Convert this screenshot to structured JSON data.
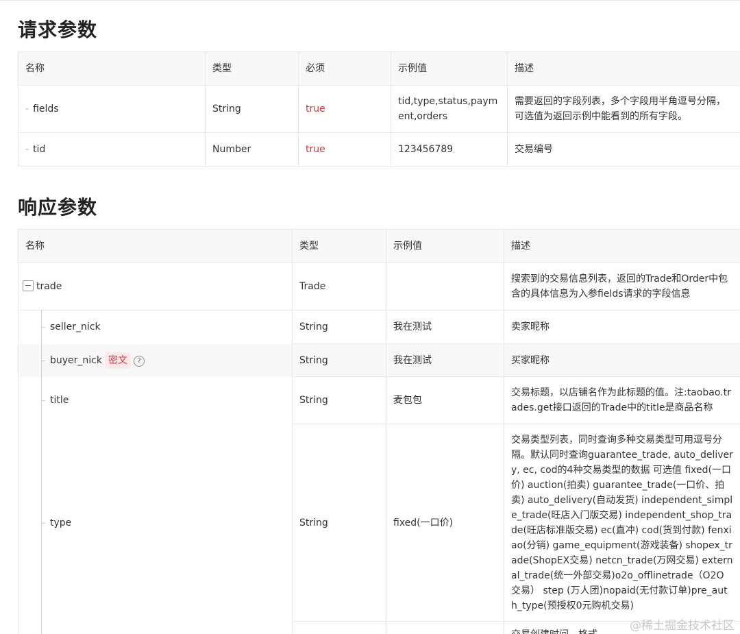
{
  "request": {
    "title": "请求参数",
    "headers": [
      "名称",
      "类型",
      "必须",
      "示例值",
      "描述"
    ],
    "rows": [
      {
        "name": "fields",
        "type": "String",
        "required": "true",
        "example": "tid,type,status,payment,orders",
        "desc": "需要返回的字段列表，多个字段用半角逗号分隔，可选值为返回示例中能看到的所有字段。"
      },
      {
        "name": "tid",
        "type": "Number",
        "required": "true",
        "example": "123456789",
        "desc": "交易编号"
      }
    ]
  },
  "response": {
    "title": "响应参数",
    "headers": [
      "名称",
      "类型",
      "示例值",
      "描述"
    ],
    "rows": [
      {
        "name": "trade",
        "type": "Trade",
        "example": "",
        "desc": "搜索到的交易信息列表，返回的Trade和Order中包含的具体信息为入参fields请求的字段信息"
      },
      {
        "name": "seller_nick",
        "type": "String",
        "example": "我在测试",
        "desc": "卖家昵称"
      },
      {
        "name": "buyer_nick",
        "badge": "密文",
        "type": "String",
        "example": "我在测试",
        "desc": "买家昵称"
      },
      {
        "name": "title",
        "type": "String",
        "example": "麦包包",
        "desc": "交易标题，以店铺名作为此标题的值。注:taobao.trades.get接口返回的Trade中的title是商品名称"
      },
      {
        "name": "type",
        "type": "String",
        "example": "fixed(一口价)",
        "desc": "交易类型列表，同时查询多种交易类型可用逗号分隔。默认同时查询guarantee_trade, auto_delivery, ec, cod的4种交易类型的数据 可选值 fixed(一口价) auction(拍卖) guarantee_trade(一口价、拍卖) auto_delivery(自动发货) independent_simple_trade(旺店入门版交易) independent_shop_trade(旺店标准版交易) ec(直冲) cod(货到付款) fenxiao(分销) game_equipment(游戏装备) shopex_trade(ShopEX交易) netcn_trade(万网交易) external_trade(统一外部交易)o2o_offlinetrade（O2O交易） step (万人团)nopaid(无付款订单)pre_auth_type(预授权0元购机交易)"
      },
      {
        "name": "",
        "type": "",
        "example": "",
        "desc": "交易创建时间。格式"
      }
    ]
  },
  "watermark": "@稀土掘金技术社区",
  "help_icon": "?"
}
